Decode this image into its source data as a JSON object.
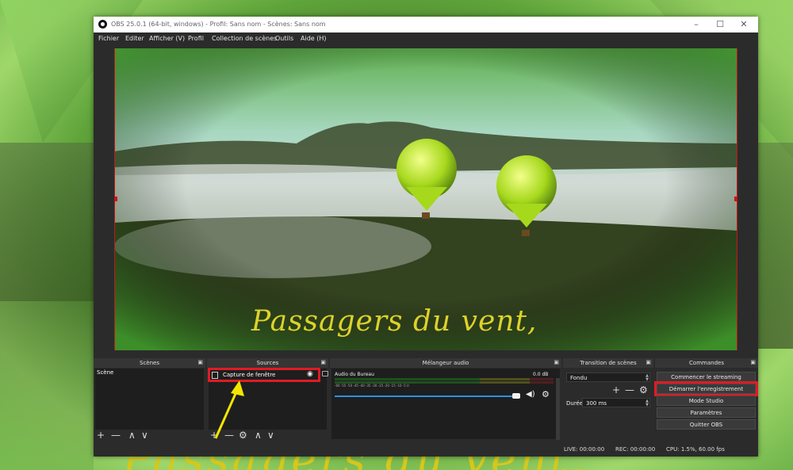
{
  "desktop": {
    "background_text": "Passagers du vent,"
  },
  "window": {
    "title": "OBS 25.0.1 (64-bit, windows) - Profil: Sans nom - Scènes: Sans nom",
    "minimize": "–",
    "maximize": "☐",
    "close": "✕"
  },
  "menu": [
    "Fichier",
    "Editer",
    "Afficher (V)",
    "Profil",
    "Collection de scènes",
    "Outils",
    "Aide (H)"
  ],
  "preview": {
    "overlay_text": "Passagers du vent,"
  },
  "docks": {
    "scenes": {
      "title": "Scènes",
      "items": [
        "Scène"
      ]
    },
    "sources": {
      "title": "Sources",
      "items": [
        {
          "label": "Capture de fenêtre",
          "visible": true
        }
      ]
    },
    "mixer": {
      "title": "Mélangeur audio",
      "track": {
        "name": "Audio du Bureau",
        "level": "0.0 dB"
      },
      "scale": "-60  -55  -50  -45  -40  -35  -30  -25  -20  -15  -10  -5  0"
    },
    "transitions": {
      "title": "Transition de scènes",
      "selected": "Fondu",
      "duration_label": "Durée",
      "duration_value": "300 ms"
    },
    "controls": {
      "title": "Commandes",
      "buttons": [
        "Commencer le streaming",
        "Démarrer l'enregistrement",
        "Mode Studio",
        "Paramètres",
        "Quitter OBS"
      ],
      "highlighted_index": 1
    }
  },
  "toolbar_glyphs": {
    "add": "+",
    "remove": "—",
    "up": "∧",
    "down": "∨",
    "gear": "⚙"
  },
  "status": {
    "live": "LIVE: 00:00:00",
    "rec": "REC: 00:00:00",
    "cpu": "CPU: 1.5%, 60.00 fps"
  },
  "colors": {
    "highlight": "#e01b24",
    "arrow": "#f2e600",
    "panel": "#2b2b2b"
  }
}
